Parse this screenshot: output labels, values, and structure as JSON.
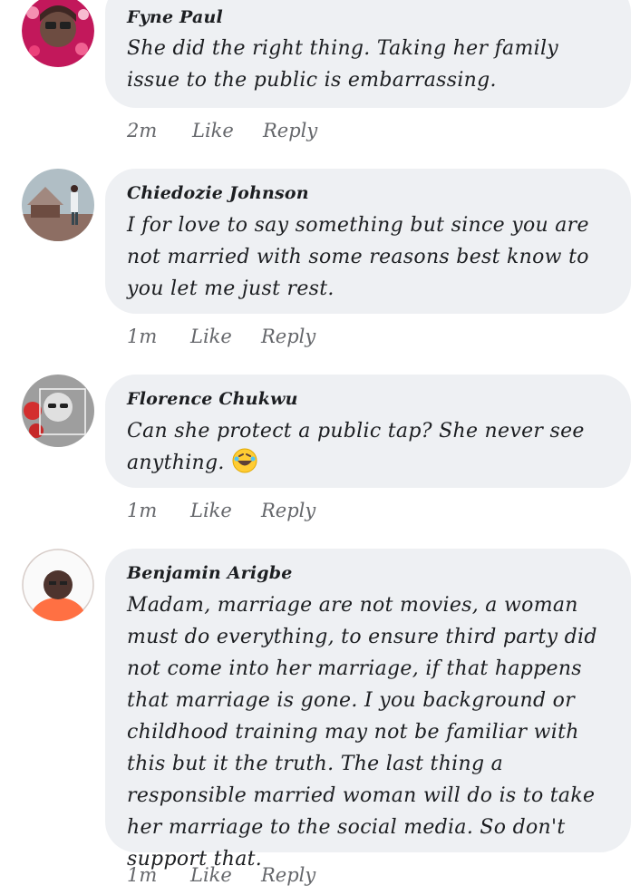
{
  "comments": [
    {
      "name": "Fyne Paul",
      "text": "She did the right thing. Taking her family issue to the public is embarrassing.",
      "time": "2m",
      "like": "Like",
      "reply": "Reply"
    },
    {
      "name": "Chiedozie Johnson",
      "text": "I for love to say something but since you are not married with some reasons best know to you let me just rest.",
      "time": "1m",
      "like": "Like",
      "reply": "Reply"
    },
    {
      "name": "Florence Chukwu",
      "text": "Can she protect a public tap? She never see anything.",
      "emoji": "rolling-on-floor-laughing",
      "time": "1m",
      "like": "Like",
      "reply": "Reply"
    },
    {
      "name": "Benjamin Arigbe",
      "text": "Madam, marriage are not movies, a woman must do everything, to ensure third party did not come into her marriage, if that happens that marriage is gone. I you background or childhood training may not be familiar with this but it the truth. The last thing a responsible married woman will do is to take her marriage to the social media. So don't support that.",
      "time": "1m",
      "like": "Like",
      "reply": "Reply"
    }
  ],
  "colors": {
    "bubble": "#eef0f3",
    "text": "#1c1e21",
    "meta": "#65676b"
  }
}
